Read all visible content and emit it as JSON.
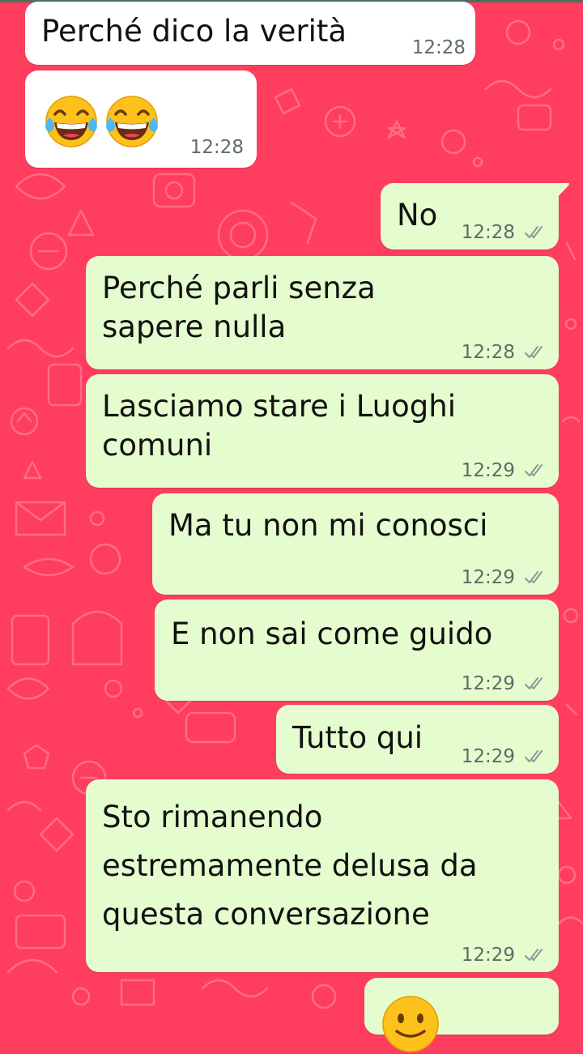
{
  "messages": [
    {
      "text": "Perché dico la verità",
      "time": "12:28",
      "direction": "incoming"
    },
    {
      "emoji": [
        "tears-of-joy",
        "tears-of-joy"
      ],
      "time": "12:28",
      "direction": "incoming"
    },
    {
      "text": "No",
      "time": "12:28",
      "direction": "outgoing",
      "status": "read"
    },
    {
      "text": "Perché parli senza\nsapere nulla",
      "time": "12:28",
      "direction": "outgoing",
      "status": "read"
    },
    {
      "text": "Lasciamo stare i Luoghi\ncomuni",
      "time": "12:29",
      "direction": "outgoing",
      "status": "read"
    },
    {
      "text": "Ma tu non mi conosci",
      "time": "12:29",
      "direction": "outgoing",
      "status": "read"
    },
    {
      "text": "E non sai come guido",
      "time": "12:29",
      "direction": "outgoing",
      "status": "read"
    },
    {
      "text": "Tutto qui",
      "time": "12:29",
      "direction": "outgoing",
      "status": "read"
    },
    {
      "text": "Sto rimanendo\nestremamente delusa da\nquesta conversazione",
      "time": "12:29",
      "direction": "outgoing",
      "status": "read"
    },
    {
      "emoji": [
        "slightly-smiling-face"
      ],
      "direction": "outgoing"
    }
  ],
  "colors": {
    "wallpaper": "#ff3d5f",
    "incoming_bubble": "#ffffff",
    "outgoing_bubble": "#e5fccf",
    "timestamp": "#5f6b66",
    "read_ticks": "#8a9a94"
  }
}
